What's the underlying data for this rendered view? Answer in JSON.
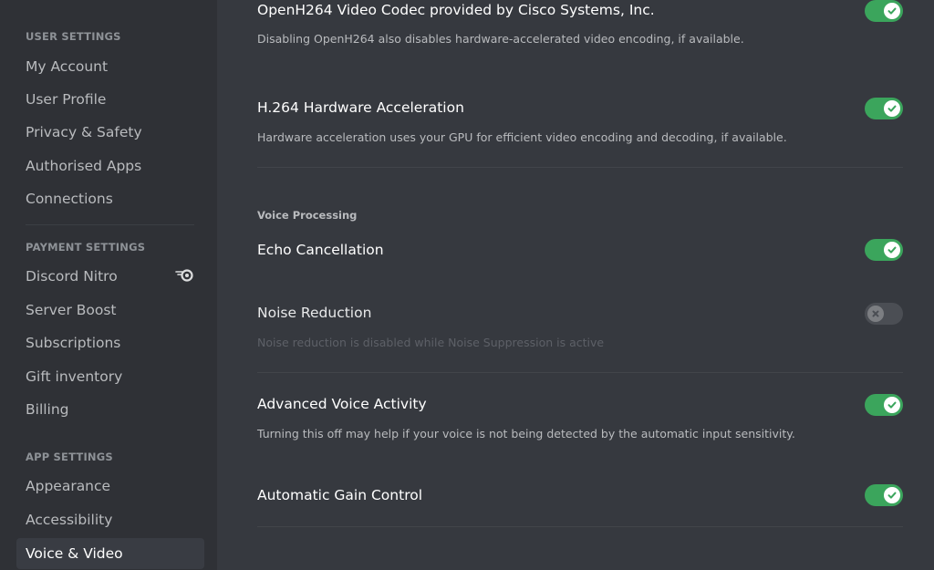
{
  "sidebar": {
    "sections": [
      {
        "header": "User Settings",
        "items": [
          {
            "label": "My Account"
          },
          {
            "label": "User Profile"
          },
          {
            "label": "Privacy & Safety"
          },
          {
            "label": "Authorised Apps"
          },
          {
            "label": "Connections"
          }
        ]
      },
      {
        "header": "Payment Settings",
        "items": [
          {
            "label": "Discord Nitro",
            "icon": "nitro-icon"
          },
          {
            "label": "Server Boost"
          },
          {
            "label": "Subscriptions"
          },
          {
            "label": "Gift inventory"
          },
          {
            "label": "Billing"
          }
        ]
      },
      {
        "header": "App Settings",
        "items": [
          {
            "label": "Appearance"
          },
          {
            "label": "Accessibility"
          },
          {
            "label": "Voice & Video",
            "selected": true
          }
        ]
      }
    ]
  },
  "main": {
    "settings": [
      {
        "title": "OpenH264 Video Codec provided by Cisco Systems, Inc.",
        "description": "Disabling OpenH264 also disables hardware-accelerated video encoding, if available.",
        "enabled": true
      },
      {
        "title": "H.264 Hardware Acceleration",
        "description": "Hardware acceleration uses your GPU for efficient video encoding and decoding, if available.",
        "enabled": true
      }
    ],
    "voice_processing": {
      "header": "Voice Processing",
      "settings": [
        {
          "title": "Echo Cancellation",
          "enabled": true
        },
        {
          "title": "Noise Reduction",
          "description": "Noise reduction is disabled while Noise Suppression is active",
          "enabled": false,
          "disabled": true
        },
        {
          "title": "Advanced Voice Activity",
          "description": "Turning this off may help if your voice is not being detected by the automatic input sensitivity.",
          "enabled": true
        },
        {
          "title": "Automatic Gain Control",
          "enabled": true
        }
      ]
    }
  },
  "colors": {
    "toggle_on": "#3ba55c",
    "toggle_off": "#72767d",
    "sidebar_bg": "#2f3136",
    "main_bg": "#36393f"
  }
}
